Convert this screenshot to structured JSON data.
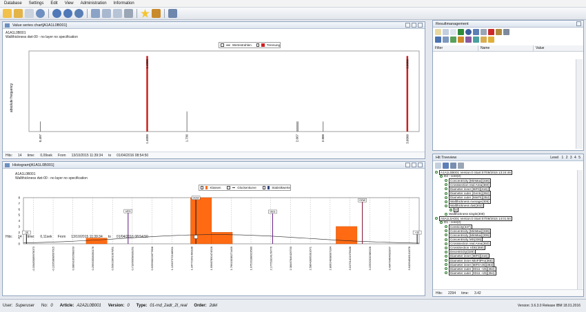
{
  "menu": [
    "Database",
    "Settings",
    "Edit",
    "View",
    "Administration",
    "Information"
  ],
  "value_chart": {
    "title": "Value series chart[A1A1L0B001]",
    "subtitle_line1": "A1A1L0B001",
    "subtitle_line2": "Wallthickness dwt-00 - no layer no specification",
    "legend": [
      "Wertestrahlen",
      "Trennung"
    ],
    "ylabel": "absolute frequency",
    "top_labels": [
      "1.4000",
      "3.6000"
    ],
    "x_labels": [
      "0.497",
      "1.4000",
      "1.736",
      "2.667",
      "2.888",
      "3.6000"
    ],
    "status": {
      "hits_label": "Hits:",
      "hits": "14",
      "time_label": "time:",
      "time": "0,09sek",
      "from_label": "From",
      "from": "13/10/2015 11:39:34",
      "to_label": "to",
      "to": "01/04/2016 08:54:50"
    }
  },
  "histogram": {
    "title": "Histogram[A1A1L0B001]",
    "subtitle_line1": "A1A1L0B001",
    "subtitle_line2": "Wallthickness dwt-00 - no layer no specification",
    "legend": [
      "Klassen",
      "Glockenkurve",
      "Statistikwerte"
    ],
    "yticks": [
      "0",
      "1",
      "2",
      "3",
      "4",
      "5",
      "6",
      "7",
      "8"
    ],
    "x_labels": [
      "-0.33483089978073",
      "-0.12053898607615",
      "0.08991962698163",
      "0.29953558090178",
      "0.50923961007851",
      "0.71966958039261",
      "0.92990022877898",
      "1.12007372108901",
      "1.34772341490188",
      "1.55687850474528",
      "1.76610038271409",
      "1.97520188023580",
      "2.17753324178776",
      "2.38467846429750",
      "2.58643066391671",
      "2.80624008007334",
      "3.01701421978188",
      "3.22552032389328",
      "3.43479464632957",
      "3.64394946131678"
    ],
    "markers": [
      "-3S",
      "UEG",
      "OGW",
      "OEG",
      "OGW",
      "+3S"
    ],
    "status": {
      "hits_label": "Hits:",
      "hits": "14",
      "time_label": "time:",
      "time": "0,11sek",
      "from_label": "From",
      "from": "13/10/2015 11:39:34",
      "to_label": "to",
      "to": "01/04/2016 08:54:50"
    }
  },
  "chart_data": [
    {
      "type": "bar",
      "title": "Value series chart[A1A1L0B001]",
      "ylabel": "absolute frequency",
      "x": [
        0.497,
        1.4,
        1.736,
        2.667,
        2.675,
        2.888,
        3.6
      ],
      "values": [
        1,
        7.5,
        2,
        1,
        1,
        1,
        7.5
      ],
      "highlight": [
        1.4,
        3.6
      ],
      "xlim": [
        0.4,
        3.7
      ]
    },
    {
      "type": "bar",
      "title": "Histogram[A1A1L0B001]",
      "categories_range": [
        -0.33,
        3.64
      ],
      "bins": [
        {
          "from": 0.299,
          "to": 0.509,
          "value": 1
        },
        {
          "from": 1.347,
          "to": 1.557,
          "value": 8
        },
        {
          "from": 1.557,
          "to": 1.766,
          "value": 2
        },
        {
          "from": 2.806,
          "to": 3.017,
          "value": 3
        }
      ],
      "ylim": [
        0,
        8
      ],
      "series": [
        {
          "name": "Klassen"
        },
        {
          "name": "Glockenkurve"
        },
        {
          "name": "Statistikwerte"
        }
      ]
    }
  ],
  "resultmanagement": {
    "title": "Resultmanagement",
    "columns": [
      "Filter",
      "Name",
      "Value"
    ]
  },
  "treeview": {
    "title": "Hit Treeview",
    "level_label": "Level",
    "levels": [
      "1",
      "2",
      "3",
      "4",
      "5"
    ],
    "rows": [
      {
        "indent": 0,
        "text": "A1A1L0B001 Version:0 Start:07/09/2015 13:24:45",
        "boxed": true
      },
      {
        "indent": 1,
        "text": "D2 - core(2)",
        "boxed": false
      },
      {
        "indent": 2,
        "text": "Concentricity [MinMax](336)",
        "boxed": true
      },
      {
        "indent": 2,
        "text": "Crosssection real Area(360)",
        "boxed": true
      },
      {
        "indent": 2,
        "text": "Diameter inner [MiFit](316)",
        "boxed": true
      },
      {
        "indent": 2,
        "text": "Diameter outer [Gentc](362)",
        "boxed": true
      },
      {
        "indent": 2,
        "text": "Diameter outer [MinFit](352)",
        "boxed": true
      },
      {
        "indent": 2,
        "text": "Wallthickness Average(305)",
        "boxed": true
      },
      {
        "indent": 2,
        "text": "Wallthickness dwt(302)",
        "boxed": true
      },
      {
        "indent": 3,
        "text": "D",
        "boxed": true
      },
      {
        "indent": 2,
        "text": "Wallthickness single(308)",
        "boxed": false
      },
      {
        "indent": 0,
        "text": "A5A1L0A001 Version:0 Start:07/09/2015 14:01:50",
        "boxed": true
      },
      {
        "indent": 1,
        "text": "D1 - core(2)",
        "boxed": false
      },
      {
        "indent": 2,
        "text": "Centricity(337)",
        "boxed": true
      },
      {
        "indent": 2,
        "text": "Concentricity [MinMax](336)",
        "boxed": true
      },
      {
        "indent": 2,
        "text": "Concentricity [MinMax](306)",
        "boxed": true
      },
      {
        "indent": 2,
        "text": "Concentricity MS(336)",
        "boxed": true
      },
      {
        "indent": 2,
        "text": "Crosssection real Area(360)",
        "boxed": true
      },
      {
        "indent": 2,
        "text": "CrossSection VDE(359)",
        "boxed": true
      },
      {
        "indent": 2,
        "text": "Decentricity(329)",
        "boxed": true
      },
      {
        "indent": 2,
        "text": "Diameter inner [MiFit](316)",
        "boxed": true
      },
      {
        "indent": 2,
        "text": "Diameter inner MinFitPro(365)",
        "boxed": true
      },
      {
        "indent": 2,
        "text": "Diameter inner [MiFit+25](363)",
        "boxed": true
      },
      {
        "indent": 2,
        "text": "Diameter outer [0D11 +25](363)",
        "boxed": true
      },
      {
        "indent": 2,
        "text": "Diameter outer [0D11 +25](364)",
        "boxed": true
      }
    ],
    "hits_label": "Hits:",
    "hits": "2294",
    "time_label": "time:",
    "time": "3.42"
  },
  "bottom": {
    "user_label": "User:",
    "user": "Superuser",
    "no_label": "No:",
    "no": "0",
    "article_label": "Article:",
    "article": "A2A2L0B001",
    "version_label": "Version:",
    "version": "0",
    "type_label": "Type:",
    "type": "01-rnd_2adr_2l_real",
    "order_label": "Order:",
    "order": "2del",
    "version_info": "Version: 3.6.3.0 Release IBM 18.01.2016"
  },
  "colors": {
    "accent": "#ff6a13",
    "redbar": "#cc1f1f",
    "dark": "#1d1d1d",
    "purple": "#6a2c8a"
  }
}
